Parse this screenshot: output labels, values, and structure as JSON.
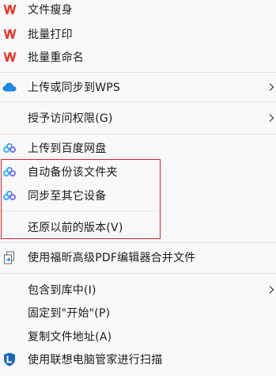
{
  "menu": {
    "items": [
      {
        "label": "文件瘦身",
        "icon": "wps-icon"
      },
      {
        "label": "批量打印",
        "icon": "wps-icon"
      },
      {
        "label": "批量重命名",
        "icon": "wps-icon"
      },
      {
        "label": "上传或同步到WPS",
        "icon": "cloud-icon",
        "submenu": true
      },
      {
        "label": "授予访问权限(G)",
        "submenu": true
      },
      {
        "label": "上传到百度网盘",
        "icon": "baidu-netdisk-icon"
      },
      {
        "label": "自动备份该文件夹",
        "icon": "baidu-netdisk-icon"
      },
      {
        "label": "同步至其它设备",
        "icon": "baidu-netdisk-icon"
      },
      {
        "label": "还原以前的版本(V)"
      },
      {
        "label": "使用福昕高级PDF编辑器合并文件",
        "icon": "foxit-merge-icon"
      },
      {
        "label": "包含到库中(I)",
        "submenu": true
      },
      {
        "label": "固定到\"开始\"(P)"
      },
      {
        "label": "复制文件地址(A)"
      },
      {
        "label": "使用联想电脑管家进行扫描",
        "icon": "lenovo-shield-icon"
      }
    ]
  },
  "colors": {
    "wps_red": "#e8382e",
    "cloud_blue": "#1e88e5",
    "highlight_border": "#d8232a"
  }
}
